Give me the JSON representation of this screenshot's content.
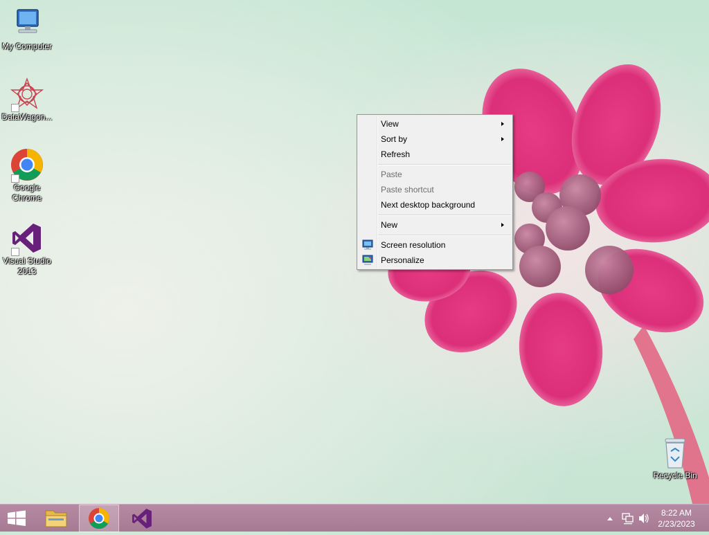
{
  "desktop_icons": [
    {
      "label": "My Computer",
      "icon": "computer-icon"
    },
    {
      "label": "DataWagon...",
      "icon": "datawagon-icon"
    },
    {
      "label": "Google Chrome",
      "icon": "chrome-icon"
    },
    {
      "label": "Visual Studio 2013",
      "icon": "visual-studio-icon"
    },
    {
      "label": "Recycle Bin",
      "icon": "recycle-bin-icon"
    }
  ],
  "context_menu": {
    "items": [
      {
        "label": "View",
        "submenu": true,
        "enabled": true
      },
      {
        "label": "Sort by",
        "submenu": true,
        "enabled": true
      },
      {
        "label": "Refresh",
        "submenu": false,
        "enabled": true
      },
      {
        "label": "Paste",
        "submenu": false,
        "enabled": false
      },
      {
        "label": "Paste shortcut",
        "submenu": false,
        "enabled": false
      },
      {
        "label": "Next desktop background",
        "submenu": false,
        "enabled": true
      },
      {
        "label": "New",
        "submenu": true,
        "enabled": true
      },
      {
        "label": "Screen resolution",
        "submenu": false,
        "enabled": true,
        "icon": "display-icon"
      },
      {
        "label": "Personalize",
        "submenu": false,
        "enabled": true,
        "icon": "personalize-icon"
      }
    ]
  },
  "taskbar": {
    "buttons": [
      {
        "name": "start",
        "icon": "windows-logo-icon"
      },
      {
        "name": "file-explorer",
        "icon": "folder-icon"
      },
      {
        "name": "chrome",
        "icon": "chrome-icon",
        "active": true
      },
      {
        "name": "visual-studio",
        "icon": "visual-studio-icon"
      }
    ],
    "tray": {
      "icons": [
        "show-hidden-icons-icon",
        "network-icon",
        "volume-icon"
      ],
      "time": "8:22 AM",
      "date": "2/23/2023"
    }
  },
  "colors": {
    "wallpaper_bg": "#c8e6d4",
    "flower_pink": "#e0307a",
    "taskbar": "#ae8199",
    "menu_bg": "#f0f0f0"
  }
}
